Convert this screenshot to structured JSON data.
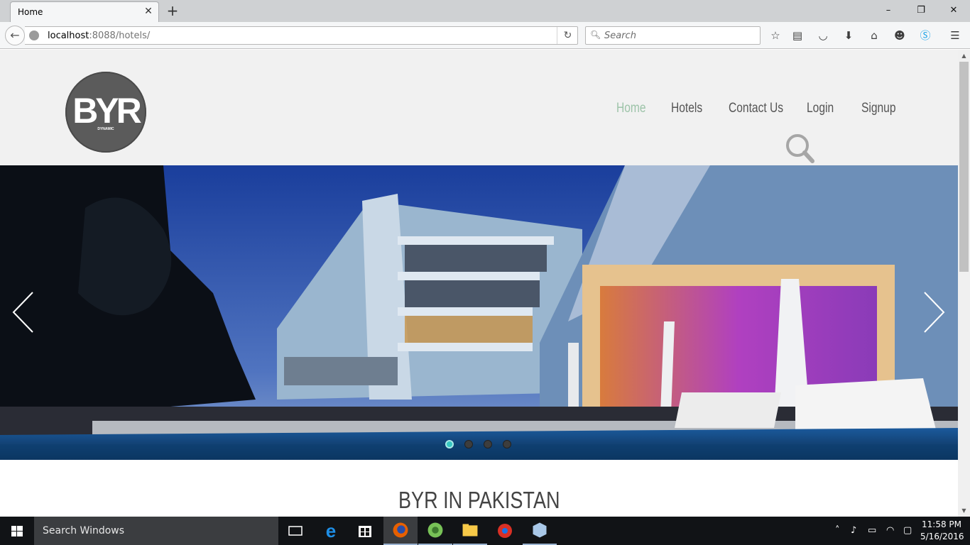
{
  "browser": {
    "tab_title": "Home",
    "tab_close": "✕",
    "new_tab": "+",
    "window_buttons": {
      "minimize": "–",
      "maximize": "❐",
      "close": "✕"
    },
    "url_host": "localhost",
    "url_rest": ":8088/hotels/",
    "search_placeholder": "Search",
    "toolbar_icons": [
      "bookmark-star-icon",
      "reading-list-icon",
      "pocket-icon",
      "download-icon",
      "home-icon",
      "chat-icon",
      "skype-icon",
      "menu-icon"
    ]
  },
  "site": {
    "logo_text": "BYR",
    "logo_subtext": "DYNAMIC",
    "nav": [
      {
        "label": "Home",
        "active": true
      },
      {
        "label": "Hotels",
        "active": false
      },
      {
        "label": "Contact Us",
        "active": false
      },
      {
        "label": "Login",
        "active": false
      },
      {
        "label": "Signup",
        "active": false
      }
    ],
    "slider": {
      "slides": 4,
      "active_slide": 1
    },
    "section_title": "BYR IN PAKISTAN",
    "colors": {
      "nav_active": "#9cc3a8",
      "nav": "#555555",
      "header_bg": "#f1f1f1",
      "slider_dot_active": "#36c6c1"
    }
  },
  "taskbar": {
    "search_placeholder": "Search Windows",
    "time": "11:58 PM",
    "date": "5/16/2016",
    "apps": [
      "task-view-icon",
      "edge-icon",
      "store-icon",
      "firefox-icon",
      "android-studio-icon",
      "file-explorer-icon",
      "browser-app-icon",
      "virtualbox-icon"
    ]
  }
}
